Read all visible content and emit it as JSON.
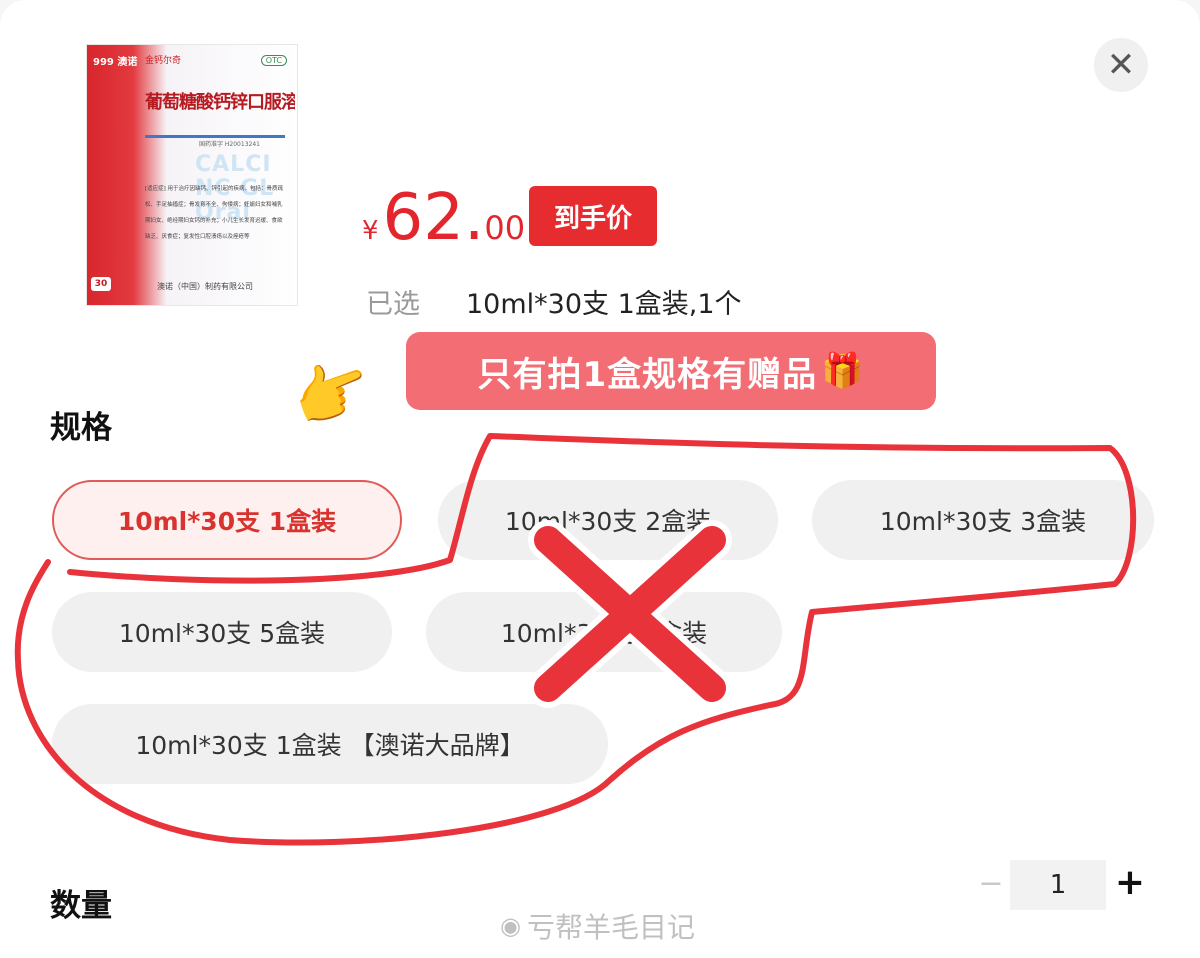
{
  "product_image": {
    "brand": "999 澳诺",
    "series": "金钙尔奇",
    "otc": "OTC",
    "title": "葡萄糖酸钙锌口服溶液",
    "approval": "国药准字 H20013241",
    "watermark_text": "CALCI NC GL Oral",
    "indications": "[适应症] 用于治疗因缺钙、锌引起的疾病，包括：骨质疏松、手足抽搐症；骨发育不全、佝偻病；妊娠妇女和哺乳期妇女、绝经期妇女钙的补充；小儿生长发育迟缓、食欲缺乏、厌食症；复发性口腔溃疡以及痤疮等",
    "count_badge": "30",
    "company": "澳诺（中国）制药有限公司"
  },
  "price": {
    "symbol": "¥",
    "integer": "62.",
    "decimal": "00",
    "tag": "到手价"
  },
  "selected": {
    "label": "已选",
    "value": "10ml*30支 1盒装,1个"
  },
  "close": {
    "glyph": "✕"
  },
  "callout": {
    "text": "只有拍1盒规格有赠品",
    "gift_icon": "🎁"
  },
  "pointer_icon": "👉",
  "spec": {
    "title": "规格",
    "options": [
      {
        "label": "10ml*30支 1盒装",
        "selected": true
      },
      {
        "label": "10ml*30支 2盒装",
        "selected": false
      },
      {
        "label": "10ml*30支 3盒装",
        "selected": false
      },
      {
        "label": "10ml*30支 5盒装",
        "selected": false
      },
      {
        "label": "10ml*30支 4盒装",
        "selected": false
      },
      {
        "label": "10ml*30支 1盒装 【澳诺大品牌】",
        "selected": false
      }
    ]
  },
  "quantity": {
    "title": "数量",
    "minus": "−",
    "value": "1",
    "plus": "+"
  },
  "watermark": {
    "icon": "weibo-icon",
    "text": "亏帮羊毛目记"
  },
  "colors": {
    "accent": "#e3262d",
    "callout_bg": "#f26d74",
    "annotation": "#e8333b"
  }
}
